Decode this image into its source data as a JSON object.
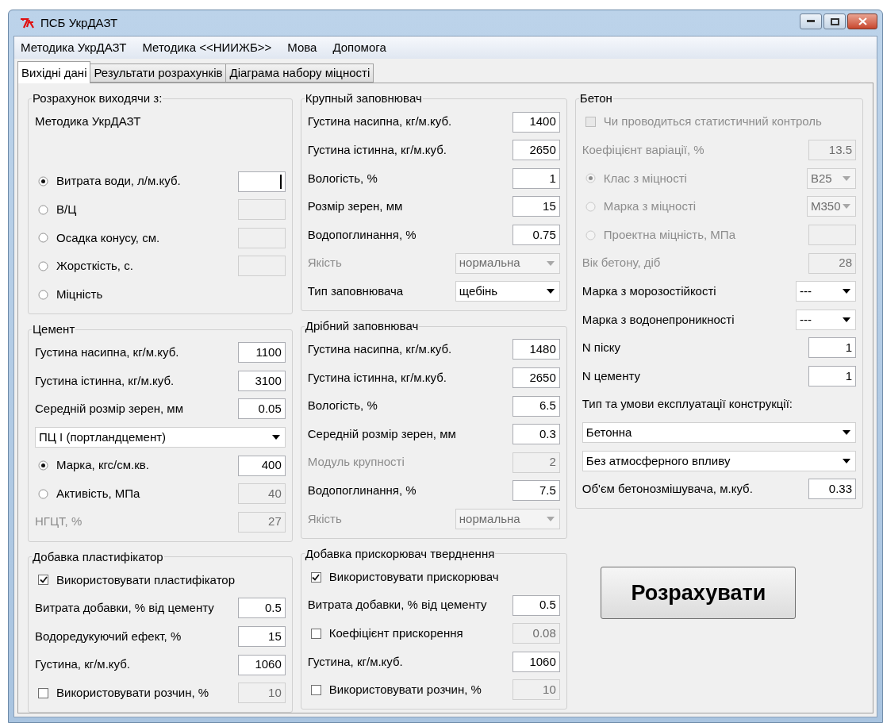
{
  "window": {
    "title": "ПСБ УкрДАЗТ"
  },
  "menu": [
    "Методика УкрДАЗТ",
    "Методика <<НИИЖБ>>",
    "Мова",
    "Допомога"
  ],
  "tabs": [
    {
      "label": "Вихідні дані",
      "selected": true
    },
    {
      "label": "Результати розрахунків",
      "selected": false
    },
    {
      "label": "Діаграма набору міцності",
      "selected": false
    }
  ],
  "columns": [
    [
      {
        "title": "Розрахунок виходячи з:",
        "rows": [
          {
            "kind": "text",
            "label": "Методика УкрДАЗТ"
          },
          {
            "kind": "radio",
            "label": "Витрата води, л/м.куб.",
            "selected": true,
            "disabled": false,
            "field": {
              "disabled": false,
              "focused": true
            }
          },
          {
            "kind": "radio",
            "label": "В/Ц",
            "selected": false,
            "disabled": false,
            "field": {
              "disabled": true
            }
          },
          {
            "kind": "radio",
            "label": "Осадка конусу, см.",
            "selected": false,
            "disabled": false,
            "field": {
              "disabled": true
            }
          },
          {
            "kind": "radio",
            "label": "Жорсткість, с.",
            "selected": false,
            "disabled": false,
            "field": {
              "disabled": true
            }
          },
          {
            "kind": "radio",
            "label": "Міцність",
            "selected": false,
            "disabled": false
          }
        ]
      },
      {
        "title": "Цемент",
        "rows": [
          {
            "kind": "input",
            "label": "Густина насипна, кг/м.куб.",
            "field": {
              "value": "1100",
              "disabled": false
            }
          },
          {
            "kind": "input",
            "label": "Густина істинна, кг/м.куб.",
            "field": {
              "value": "3100",
              "disabled": false
            }
          },
          {
            "kind": "input",
            "label": "Середній розмір зерен, мм",
            "field": {
              "value": "0.05",
              "disabled": false
            }
          },
          {
            "kind": "wide-select",
            "value": "ПЦ І (портландцемент)",
            "disabled": false
          },
          {
            "kind": "radio",
            "label": "Марка, кгс/см.кв.",
            "selected": true,
            "disabled": false,
            "field": {
              "value": "400",
              "disabled": false
            }
          },
          {
            "kind": "radio",
            "label": "Активість, МПа",
            "selected": false,
            "disabled": false,
            "field": {
              "value": "40",
              "disabled": true
            }
          },
          {
            "kind": "input",
            "label": "НГЦТ, %",
            "disabled": true,
            "field": {
              "value": "27",
              "disabled": true
            }
          }
        ]
      },
      {
        "title": "Добавка пластифікатор",
        "rows": [
          {
            "kind": "check",
            "label": "Використовувати пластифікатор",
            "checked": true,
            "disabled": false
          },
          {
            "kind": "input",
            "label": "Витрата добавки, % від цементу",
            "field": {
              "value": "0.5",
              "disabled": false
            }
          },
          {
            "kind": "input",
            "label": "Водоредукуючий ефект, %",
            "field": {
              "value": "15",
              "disabled": false
            }
          },
          {
            "kind": "input",
            "label": "Густина, кг/м.куб.",
            "field": {
              "value": "1060",
              "disabled": false
            }
          },
          {
            "kind": "check",
            "label": "Використовувати розчин, %",
            "checked": false,
            "disabled": false,
            "field": {
              "value": "10",
              "disabled": true
            }
          }
        ]
      }
    ],
    [
      {
        "title": "Крупный заповнювач",
        "rows": [
          {
            "kind": "input",
            "label": "Густина насипна, кг/м.куб.",
            "field": {
              "value": "1400",
              "disabled": false
            }
          },
          {
            "kind": "input",
            "label": "Густина істинна, кг/м.куб.",
            "field": {
              "value": "2650",
              "disabled": false
            }
          },
          {
            "kind": "input",
            "label": "Вологість, %",
            "field": {
              "value": "1",
              "disabled": false
            }
          },
          {
            "kind": "input",
            "label": "Розмір зерен, мм",
            "field": {
              "value": "15",
              "disabled": false
            }
          },
          {
            "kind": "input",
            "label": "Водопоглинання, %",
            "field": {
              "value": "0.75",
              "disabled": false
            }
          },
          {
            "kind": "select",
            "label": "Якість",
            "disabled": true,
            "value": "нормальна"
          },
          {
            "kind": "select",
            "label": "Тип заповнювача",
            "disabled": false,
            "value": "щебінь"
          }
        ]
      },
      {
        "title": "Дрібний заповнювач",
        "rows": [
          {
            "kind": "input",
            "label": "Густина насипна, кг/м.куб.",
            "field": {
              "value": "1480",
              "disabled": false
            }
          },
          {
            "kind": "input",
            "label": "Густина істинна, кг/м.куб.",
            "field": {
              "value": "2650",
              "disabled": false
            }
          },
          {
            "kind": "input",
            "label": "Вологість, %",
            "field": {
              "value": "6.5",
              "disabled": false
            }
          },
          {
            "kind": "input",
            "label": "Середній розмір зерен, мм",
            "field": {
              "value": "0.3",
              "disabled": false
            }
          },
          {
            "kind": "input",
            "label": "Модуль крупності",
            "disabled": true,
            "field": {
              "value": "2",
              "disabled": true
            }
          },
          {
            "kind": "input",
            "label": "Водопоглинання, %",
            "field": {
              "value": "7.5",
              "disabled": false
            }
          },
          {
            "kind": "select",
            "label": "Якість",
            "disabled": true,
            "value": "нормальна"
          }
        ]
      },
      {
        "title": "Добавка прискорювач тверднення",
        "rows": [
          {
            "kind": "check",
            "label": "Використовувати прискорювач",
            "checked": true,
            "disabled": false
          },
          {
            "kind": "input",
            "label": "Витрата добавки, % від цементу",
            "field": {
              "value": "0.5",
              "disabled": false
            }
          },
          {
            "kind": "check",
            "label": "Коефіцієнт прискорення",
            "checked": false,
            "disabled": false,
            "field": {
              "value": "0.08",
              "disabled": true
            }
          },
          {
            "kind": "input",
            "label": "Густина, кг/м.куб.",
            "field": {
              "value": "1060",
              "disabled": false
            }
          },
          {
            "kind": "check",
            "label": "Використовувати розчин, %",
            "checked": false,
            "disabled": false,
            "field": {
              "value": "10",
              "disabled": true
            }
          }
        ]
      }
    ],
    [
      {
        "title": "Бетон",
        "rows": [
          {
            "kind": "check",
            "label": "Чи проводиться статистичний контроль",
            "checked": false,
            "disabled": true
          },
          {
            "kind": "input",
            "label": "Коефіцієнт варіації, %",
            "disabled": true,
            "field": {
              "value": "13.5",
              "disabled": true
            }
          },
          {
            "kind": "radio",
            "label": "Клас з міцності",
            "selected": true,
            "disabled": true,
            "select": {
              "value": "B25",
              "disabled": true
            }
          },
          {
            "kind": "radio",
            "label": "Марка з міцності",
            "selected": false,
            "disabled": true,
            "select": {
              "value": "M350",
              "disabled": true
            }
          },
          {
            "kind": "radio",
            "label": "Проектна міцність, МПа",
            "selected": false,
            "disabled": true,
            "field": {
              "disabled": true
            }
          },
          {
            "kind": "input",
            "label": "Вік бетону, діб",
            "disabled": true,
            "field": {
              "value": "28",
              "disabled": true
            }
          },
          {
            "kind": "small-select",
            "label": "Марка з морозостійкості",
            "disabled": false,
            "value": "---"
          },
          {
            "kind": "small-select",
            "label": "Марка з водонепроникності",
            "disabled": false,
            "value": "---"
          },
          {
            "kind": "input",
            "label": "N піску",
            "field": {
              "value": "1",
              "disabled": false
            }
          },
          {
            "kind": "input",
            "label": "N цементу",
            "field": {
              "value": "1",
              "disabled": false
            }
          },
          {
            "kind": "text",
            "label": "Тип та умови експлуатації конструкції:"
          },
          {
            "kind": "wide-select",
            "value": "Бетонна",
            "disabled": false
          },
          {
            "kind": "wide-select",
            "value": "Без атмосферного впливу",
            "disabled": false
          },
          {
            "kind": "input",
            "label": "Об'єм бетонозмішувача, м.куб.",
            "field": {
              "value": "0.33",
              "disabled": false
            }
          }
        ]
      }
    ]
  ],
  "calculate_button": "Розрахувати"
}
